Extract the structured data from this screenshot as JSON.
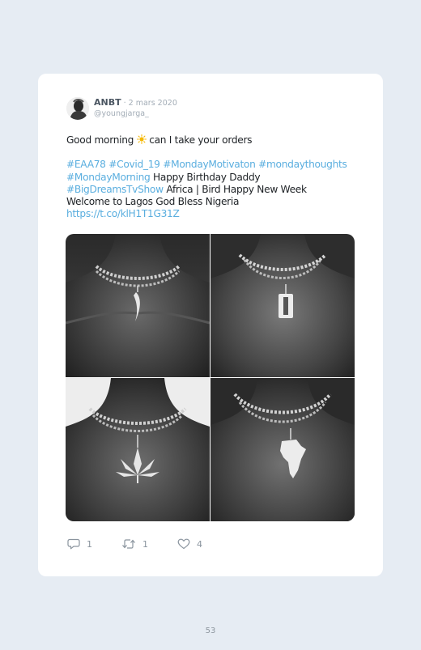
{
  "tweet": {
    "author_name": "ANBT",
    "date": " · 2 mars 2020",
    "handle": "@youngjarga_",
    "text_line1_before": "Good morning ",
    "text_line1_after": " can I take your orders",
    "sun_emoji": "sun-icon",
    "hashtags_line1": "#EAA78 #Covid_19 #MondayMotivaton #mondaythoughts",
    "hashtag_monday_morning": "#MondayMorning",
    "text_birthday": " Happy Birthday Daddy",
    "hashtag_bigdreams": "#BigDreamsTvShow",
    "text_africa": " Africa | Bird Happy New Week",
    "text_welcome": "Welcome to Lagos God Bless Nigeria",
    "link": "https://t.co/klH1T1G31Z",
    "link_color": "#5aaedf"
  },
  "media": [
    {
      "pendant": "horn-pendant"
    },
    {
      "pendant": "razor-blade-pendant"
    },
    {
      "pendant": "leaf-pendant"
    },
    {
      "pendant": "africa-map-pendant"
    }
  ],
  "actions": {
    "reply_count": "1",
    "retweet_count": "1",
    "like_count": "4"
  },
  "page": {
    "number": "53"
  }
}
